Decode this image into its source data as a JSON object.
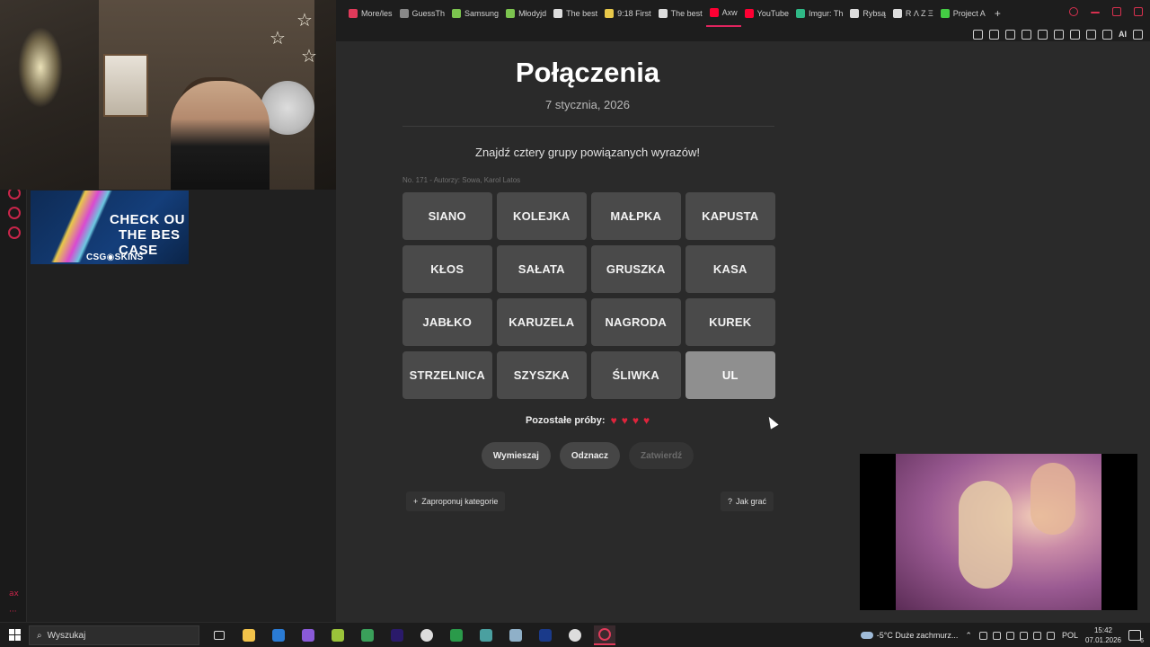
{
  "browser": {
    "tabs": [
      {
        "label": "More/les",
        "color": "#e03a5a"
      },
      {
        "label": "GuessTh",
        "color": "#888888"
      },
      {
        "label": "Samsung",
        "color": "#7cc44f"
      },
      {
        "label": "Młodyjd",
        "color": "#7cc44f"
      },
      {
        "label": "The best",
        "color": "#dddddd"
      },
      {
        "label": "9:18 First",
        "color": "#e8c84a"
      },
      {
        "label": "The best",
        "color": "#dddddd"
      },
      {
        "label": "Axw",
        "color": "#ff0033"
      },
      {
        "label": "YouTube",
        "color": "#ff0033"
      },
      {
        "label": "Imgur: Th",
        "color": "#2fb886"
      },
      {
        "label": "Rybsą",
        "color": "#dddddd"
      },
      {
        "label": "R Λ Z Ξ",
        "color": "#dddddd"
      },
      {
        "label": "Project A",
        "color": "#44cc44"
      }
    ],
    "new_tab": "+",
    "toolbar_ai": "AI"
  },
  "sponsor": {
    "line1": "CHECK OU",
    "line2": "THE BES",
    "line3": "CASE",
    "brand": "CSG◉SKINS"
  },
  "game": {
    "title": "Połączenia",
    "date": "7 stycznia, 2026",
    "subtitle": "Znajdź cztery grupy powiązanych wyrazów!",
    "meta": "No. 171 - Autorzy: Sowa, Karol Latos",
    "tiles": [
      {
        "word": "SIANO",
        "selected": false
      },
      {
        "word": "KOLEJKA",
        "selected": false
      },
      {
        "word": "MAŁPKA",
        "selected": false
      },
      {
        "word": "KAPUSTA",
        "selected": false
      },
      {
        "word": "KŁOS",
        "selected": false
      },
      {
        "word": "SAŁATA",
        "selected": false
      },
      {
        "word": "GRUSZKA",
        "selected": false
      },
      {
        "word": "KASA",
        "selected": false
      },
      {
        "word": "JABŁKO",
        "selected": false
      },
      {
        "word": "KARUZELA",
        "selected": false
      },
      {
        "word": "NAGRODA",
        "selected": false
      },
      {
        "word": "KUREK",
        "selected": false
      },
      {
        "word": "STRZELNICA",
        "selected": false
      },
      {
        "word": "SZYSZKA",
        "selected": false
      },
      {
        "word": "ŚLIWKA",
        "selected": false
      },
      {
        "word": "UL",
        "selected": true
      }
    ],
    "tries_label": "Pozostałe próby:",
    "tries_remaining": 4,
    "heart_glyph": "♥",
    "buttons": {
      "shuffle": "Wymieszaj",
      "deselect": "Odznacz",
      "submit": "Zatwierdź"
    },
    "suggest_label": "Zaproponuj kategorie",
    "howto_label": "Jak grać",
    "colors": {
      "tile": "#4a4a4a",
      "tile_selected": "#8f8f8f",
      "heart": "#e0243c",
      "accent": "#e0245e"
    }
  },
  "left_sidebar": {
    "label": "ax"
  },
  "taskbar": {
    "search_placeholder": "Wyszukaj",
    "weather": "-5°C  Duże zachmurz...",
    "language": "POL",
    "time": "15:42",
    "date": "07.01.2026",
    "notifications": "6"
  }
}
